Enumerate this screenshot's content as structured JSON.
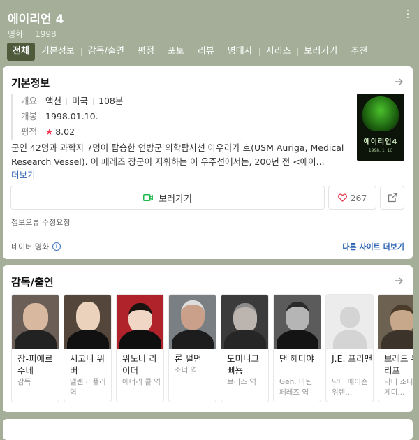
{
  "header": {
    "title": "에이리언 4",
    "category": "영화",
    "year": "1998",
    "tabs": [
      "전체",
      "기본정보",
      "감독/출연",
      "평점",
      "포토",
      "리뷰",
      "명대사",
      "시리즈",
      "보러가기",
      "추천"
    ]
  },
  "basic_info": {
    "title": "기본정보",
    "rows": {
      "overview_key": "개요",
      "genre": "액션",
      "country": "미국",
      "runtime": "108분",
      "release_key": "개봉",
      "release_date": "1998.01.10.",
      "rating_key": "평점",
      "rating": "8.02"
    },
    "poster": {
      "title": "에이리언4",
      "date": "1998. 1. 10"
    },
    "synopsis": "군인 42명과 과학자 7명이 탑승한 연방군 의학탐사선 아우리가 호(USM Auriga, Medical Research Vessel). 이 페레즈 장군이 지휘하는 이 우주선에서는, 200년 전 <에이...",
    "more": "더보기",
    "watch_label": "보러가기",
    "like_count": "267",
    "report": "정보오류 수정요청",
    "source": "네이버 영화",
    "other_sites": "다른 사이트 더보기"
  },
  "cast": {
    "title": "감독/출연",
    "people": [
      {
        "name": "장-피에르 주네",
        "role": "감독"
      },
      {
        "name": "시고니 위버",
        "role": "엘렌 리플리 역"
      },
      {
        "name": "위노나 라이더",
        "role": "애너리 콜 역"
      },
      {
        "name": "론 펄먼",
        "role": "조너 역"
      },
      {
        "name": "도미니크 삐뇽",
        "role": "브리스 역"
      },
      {
        "name": "댄 헤다야",
        "role": "Gen. 마틴 페레즈 역"
      },
      {
        "name": "J.E. 프리맨",
        "role": "닥터 메이슨 위렌..."
      },
      {
        "name": "브래드 듀리프",
        "role": "닥터 조나단 게디..."
      }
    ]
  },
  "colors": {
    "header_bg": "#a4ae98",
    "active_tab": "#4d5a3c",
    "link_blue": "#2c63b2",
    "watch_icon": "#21b94c",
    "star_red": "#f0334f"
  }
}
